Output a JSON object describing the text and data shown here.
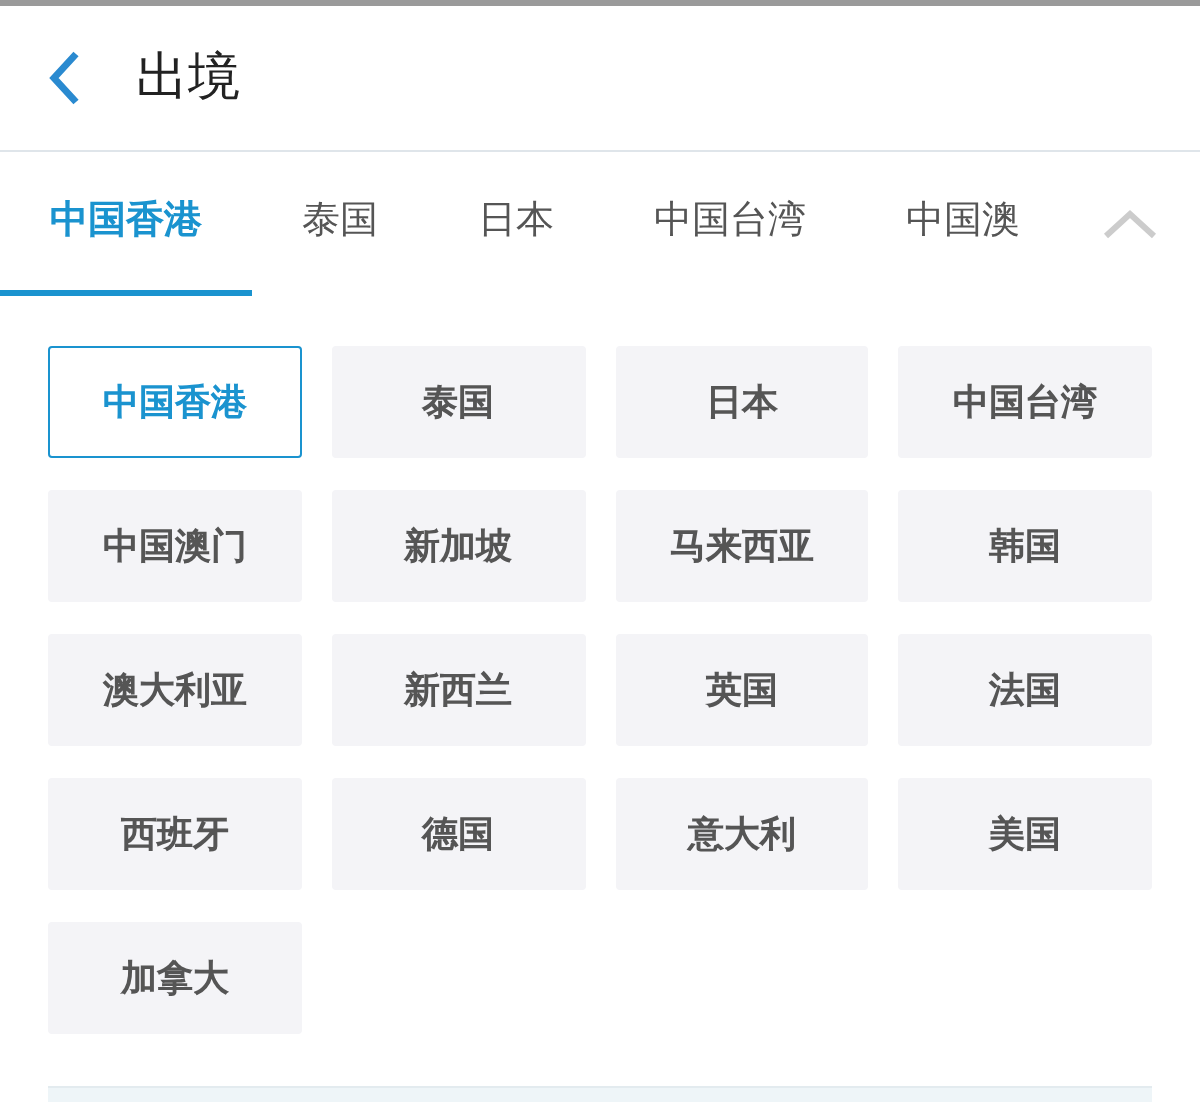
{
  "header": {
    "title": "出境"
  },
  "tabs": [
    {
      "label": "中国香港",
      "selected": true
    },
    {
      "label": "泰国",
      "selected": false
    },
    {
      "label": "日本",
      "selected": false
    },
    {
      "label": "中国台湾",
      "selected": false
    },
    {
      "label": "中国澳",
      "selected": false
    }
  ],
  "regions": [
    {
      "label": "中国香港",
      "selected": true
    },
    {
      "label": "泰国",
      "selected": false
    },
    {
      "label": "日本",
      "selected": false
    },
    {
      "label": "中国台湾",
      "selected": false
    },
    {
      "label": "中国澳门",
      "selected": false
    },
    {
      "label": "新加坡",
      "selected": false
    },
    {
      "label": "马来西亚",
      "selected": false
    },
    {
      "label": "韩国",
      "selected": false
    },
    {
      "label": "澳大利亚",
      "selected": false
    },
    {
      "label": "新西兰",
      "selected": false
    },
    {
      "label": "英国",
      "selected": false
    },
    {
      "label": "法国",
      "selected": false
    },
    {
      "label": "西班牙",
      "selected": false
    },
    {
      "label": "德国",
      "selected": false
    },
    {
      "label": "意大利",
      "selected": false
    },
    {
      "label": "美国",
      "selected": false
    },
    {
      "label": "加拿大",
      "selected": false
    }
  ]
}
